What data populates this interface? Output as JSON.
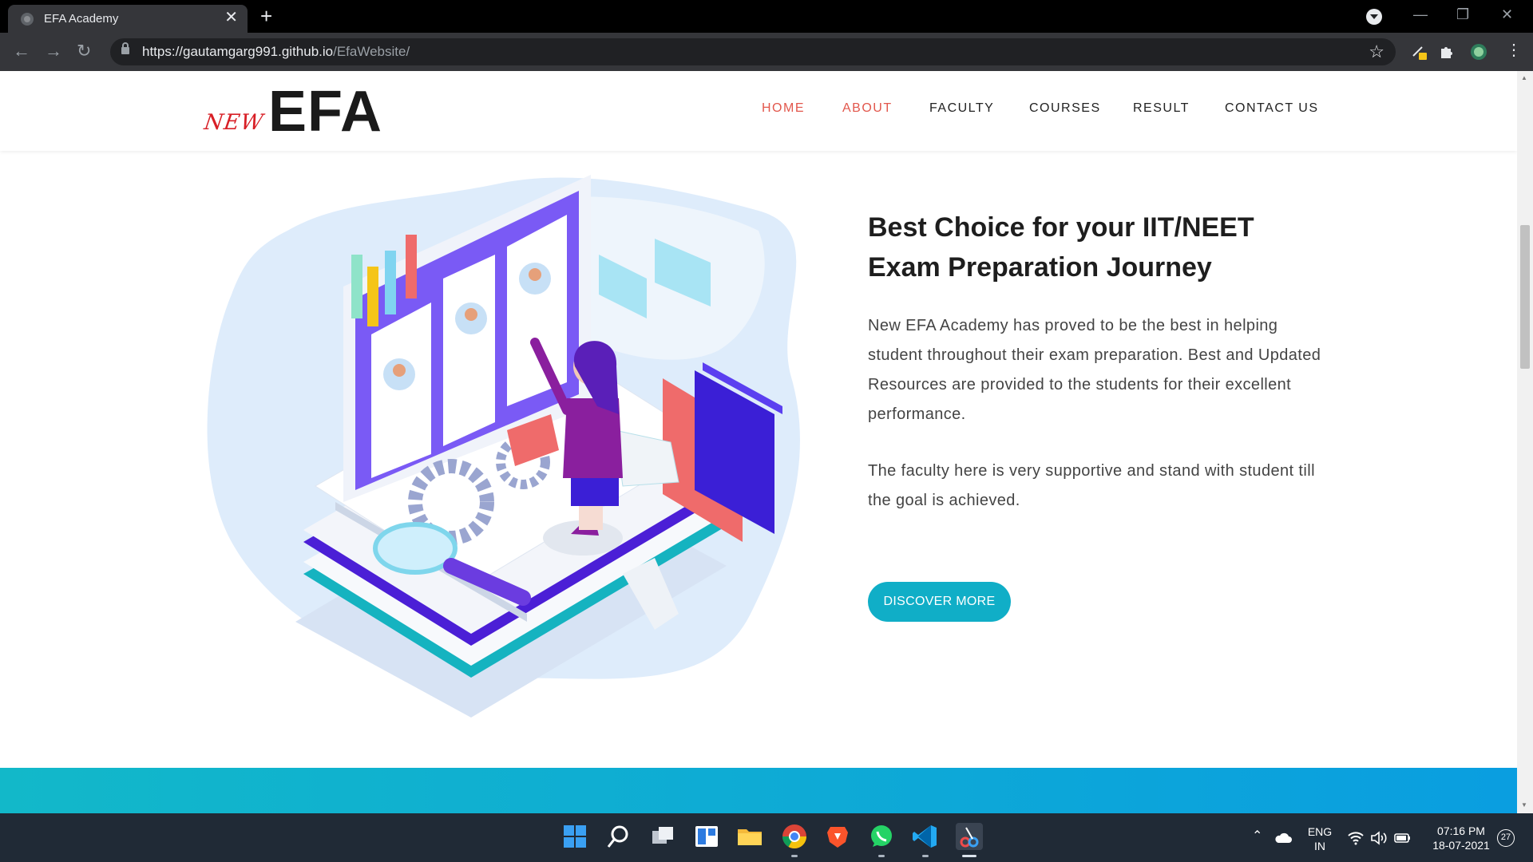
{
  "browser": {
    "tab_title": "EFA Academy",
    "tab_close": "✕",
    "new_tab": "+",
    "url_host": "https://gautamgarg991.github.io",
    "url_path": "/EfaWebsite/",
    "back": "←",
    "forward": "→",
    "reload": "↻",
    "star": "☆",
    "minimize": "—",
    "restore": "❐",
    "close": "✕"
  },
  "site": {
    "logo_new": "NEW",
    "logo_main": "EFA",
    "nav": [
      "HOME",
      "ABOUT",
      "FACULTY",
      "COURSES",
      "RESULT",
      "CONTACT US"
    ],
    "active_nav": [
      "HOME",
      "ABOUT"
    ]
  },
  "about": {
    "heading": "Best Choice for your IIT/NEET Exam Preparation Journey",
    "paragraph_1": "New EFA Academy has proved to be the best in helping student throughout their exam preparation. Best and Updated Resources are provided to the students for their excellent performance.",
    "paragraph_2": "The faculty here is very supportive and stand with student till the goal is achieved.",
    "cta": "DISCOVER MORE"
  },
  "taskbar": {
    "language": "ENG",
    "region": "IN",
    "time": "07:16 PM",
    "date": "18-07-2021",
    "notification_count": "27"
  },
  "icons": [
    "globe-icon",
    "close-icon",
    "plus-icon",
    "back-arrow-icon",
    "forward-arrow-icon",
    "reload-icon",
    "lock-icon",
    "star-icon",
    "puzzle-icon",
    "windows-start-icon",
    "search-icon",
    "task-view-icon",
    "widgets-icon",
    "folder-icon",
    "chrome-icon",
    "brave-icon",
    "whatsapp-icon",
    "vscode-icon",
    "wifi-icon",
    "volume-icon",
    "battery-icon",
    "cloud-icon"
  ],
  "colors": {
    "accent": "#10aec7",
    "nav_active": "#e2574c",
    "logo_red": "#d81f26",
    "band_start": "#12b8c9",
    "band_end": "#0a9ee0"
  }
}
